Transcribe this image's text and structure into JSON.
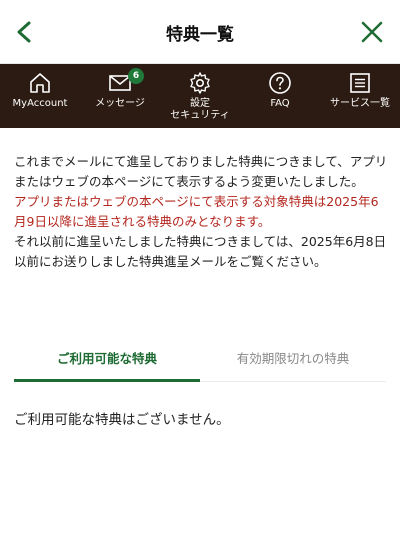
{
  "header": {
    "title": "特典一覧",
    "accent_color": "#1f6b34"
  },
  "nav": {
    "items": [
      {
        "label": "MyAccount",
        "icon": "home-icon"
      },
      {
        "label": "メッセージ",
        "icon": "mail-icon",
        "badge": "6"
      },
      {
        "label": "設定\nセキュリティ",
        "icon": "gear-icon"
      },
      {
        "label": "FAQ",
        "icon": "question-icon"
      },
      {
        "label": "サービス一覧",
        "icon": "list-icon"
      }
    ],
    "background": "#2b1b12"
  },
  "notice": {
    "line1": "これまでメールにて進呈しておりました特典につきまして、アプリまたはウェブの本ページにて表示するよう変更いたしました。",
    "line2_red": "アプリまたはウェブの本ページにて表示する対象特典は2025年6月9日以降に進呈される特典のみとなります。",
    "line3": "それ以前に進呈いたしました特典につきましては、2025年6月8日以前にお送りしました特典進呈メールをご覧ください。",
    "red_color": "#b3261e"
  },
  "tabs": {
    "available": "ご利用可能な特典",
    "expired": "有効期限切れの特典"
  },
  "empty_message": "ご利用可能な特典はございません。"
}
